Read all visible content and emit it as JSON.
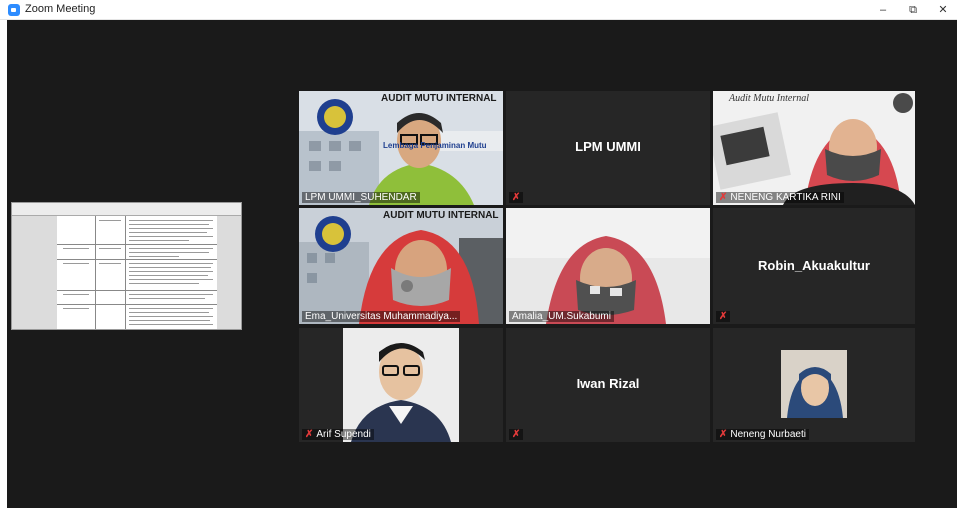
{
  "window": {
    "title": "Zoom Meeting",
    "minimize": "–",
    "restore": "⧉",
    "close": "✕"
  },
  "colors": {
    "accent": "#2d8cff",
    "active_border": "#e3e35c",
    "mute": "#e23a3a"
  },
  "participants": [
    {
      "name": "LPM UMMI_SUHENDAR",
      "video": true,
      "muted": false,
      "banner": "AUDIT MUTU INTERNAL",
      "banner2": "Lembaga Penjaminan Mutu"
    },
    {
      "name": "LPM UMMI",
      "video": false,
      "muted": true
    },
    {
      "name": "NENENG KARTIKA RINI",
      "video": true,
      "muted": true,
      "banner": "Audit Mutu Internal"
    },
    {
      "name": "Ema_Universitas Muhammadiya...",
      "video": true,
      "muted": false,
      "active": true,
      "banner": "AUDIT MUTU INTERNAL"
    },
    {
      "name": "Amalia_UM.Sukabumi",
      "video": true,
      "muted": false
    },
    {
      "name": "Robin_Akuakultur",
      "video": false,
      "muted": true
    },
    {
      "name": "Arif Supendi",
      "video": true,
      "muted": true
    },
    {
      "name": "Iwan Rizal",
      "video": false,
      "muted": true
    },
    {
      "name": "Neneng Nurbaeti",
      "video": true,
      "muted": true
    }
  ]
}
